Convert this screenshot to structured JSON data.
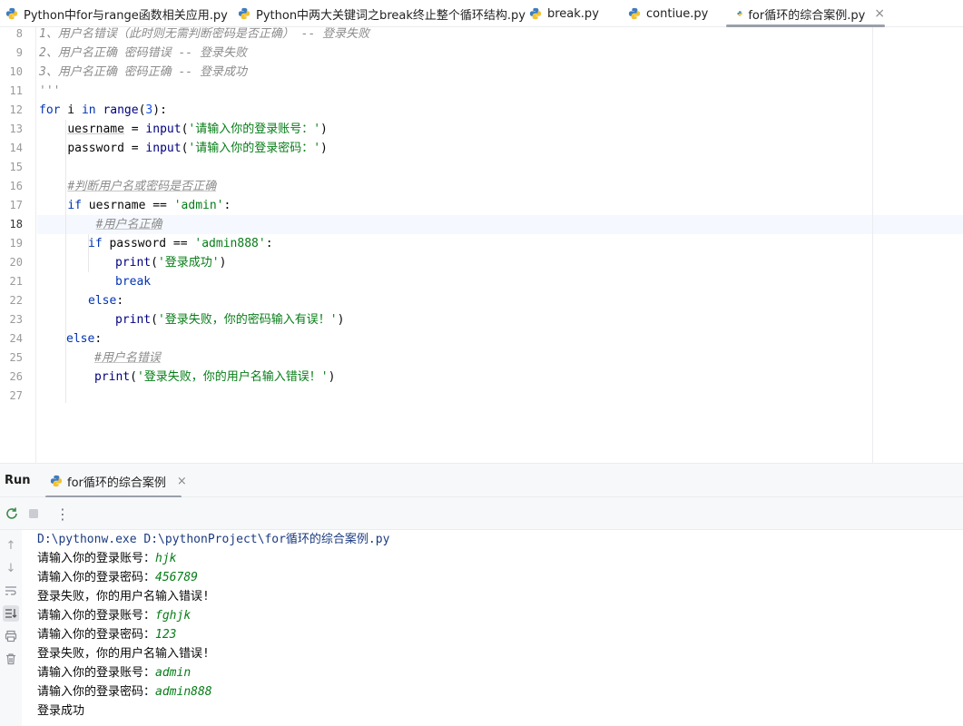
{
  "tabs": [
    {
      "label": "Python中for与range函数相关应用.py",
      "active": false
    },
    {
      "label": "Python中两大关键词之break终止整个循环结构.py",
      "active": false
    },
    {
      "label": "break.py",
      "active": false
    },
    {
      "label": "contiue.py",
      "active": false
    },
    {
      "label": "for循环的综合案例.py",
      "active": true,
      "close": "×"
    }
  ],
  "editor": {
    "current_line": 18,
    "line_numbers": [
      "8",
      "9",
      "10",
      "11",
      "12",
      "13",
      "14",
      "15",
      "16",
      "17",
      "18",
      "19",
      "20",
      "21",
      "22",
      "23",
      "24",
      "25",
      "26",
      "27"
    ],
    "lines": {
      "l8": "1、用户名错误（此时则无需判断密码是否正确） -- 登录失败",
      "l9": "2、用户名正确 密码错误 -- 登录失败",
      "l10": "3、用户名正确 密码正确 -- 登录成功",
      "l11": "'''",
      "l12_for": "for",
      "l12_i": " i ",
      "l12_in": "in",
      "l12_range": "range",
      "l12_open": "(",
      "l12_num": "3",
      "l12_close": "):",
      "l13_var": "uesrname",
      "l13_eq": " = ",
      "l13_fn": "input",
      "l13_str": "'请输入你的登录账号：'",
      "l13_end": ")",
      "l14_var": "password",
      "l14_eq": " = ",
      "l14_fn": "input",
      "l14_str": "'请输入你的登录密码：'",
      "l14_end": ")",
      "l16": "#判断用户名或密码是否正确",
      "l17_if": "if",
      "l17_mid": " uesrname == ",
      "l17_str": "'admin'",
      "l17_end": ":",
      "l18": "#用户名正确",
      "l19_if": "if",
      "l19_mid": " password == ",
      "l19_str": "'admin888'",
      "l19_end": ":",
      "l20_fn": "print",
      "l20_str": "'登录成功'",
      "l21": "break",
      "l22": "else",
      "l22_end": ":",
      "l23_fn": "print",
      "l23_str": "'登录失败，你的密码输入有误！'",
      "l24": "else",
      "l24_end": ":",
      "l25": "#用户名错误",
      "l26_fn": "print",
      "l26_str": "'登录失败，你的用户名输入错误！'"
    }
  },
  "run": {
    "title": "Run",
    "tab_label": "for循环的综合案例",
    "tab_close": "×",
    "output": {
      "cmd": "D:\\pythonw.exe D:\\pythonProject\\for循环的综合案例.py",
      "p1": "请输入你的登录账号：",
      "v1": "hjk",
      "p2": "请输入你的登录密码：",
      "v2": "456789",
      "r1": "登录失败，你的用户名输入错误!",
      "p3": "请输入你的登录账号：",
      "v3": "fghjk",
      "p4": "请输入你的登录密码：",
      "v4": "123",
      "r2": "登录失败，你的用户名输入错误!",
      "p5": "请输入你的登录账号：",
      "v5": "admin",
      "p6": "请输入你的登录密码：",
      "v6": "admin888",
      "r3": "登录成功"
    }
  },
  "colors": {
    "keyword": "#0033b3",
    "string": "#067d17",
    "number": "#1750eb",
    "comment": "#8c8c8c",
    "builtin": "#000080"
  }
}
